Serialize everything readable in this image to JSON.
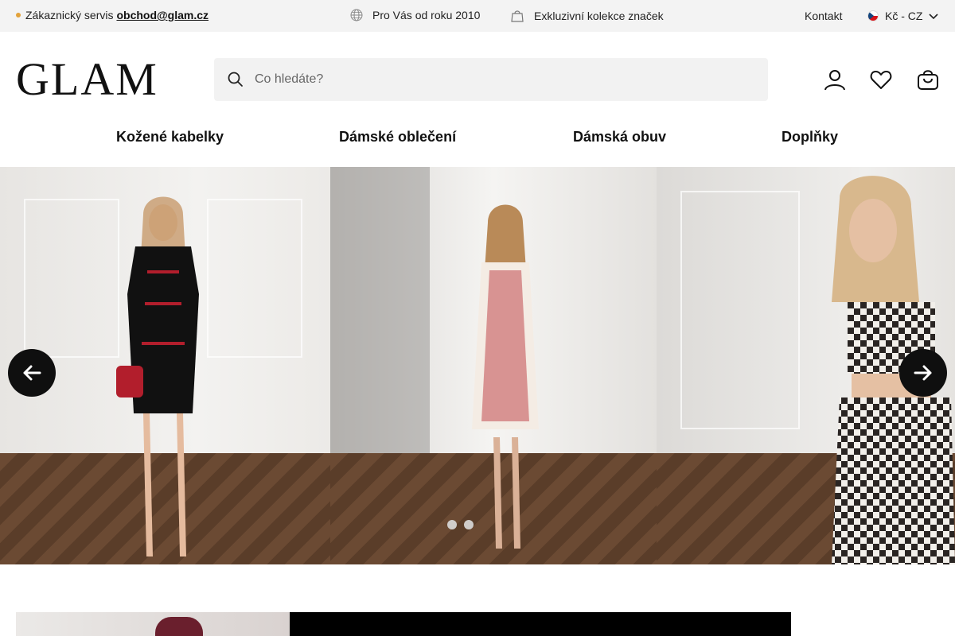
{
  "topbar": {
    "customer_service_label": "Zákaznický servis",
    "customer_service_email": "obchod@glam.cz",
    "since_label": "Pro Vás od roku 2010",
    "exclusive_label": "Exkluzivní kolekce značek",
    "contact_label": "Kontakt",
    "currency_label": "Kč - CZ"
  },
  "header": {
    "logo": "GLAM",
    "search_placeholder": "Co hledáte?"
  },
  "nav": {
    "items": [
      "Kožené kabelky",
      "Dámské oblečení",
      "Dámská obuv",
      "Doplňky"
    ]
  },
  "hero": {
    "slide_count": 2,
    "active_slide": 0
  },
  "colors": {
    "topbar_bg": "#f3f3f3",
    "accent_dot": "#e2a23a",
    "dark_button": "#0f0f0f"
  }
}
